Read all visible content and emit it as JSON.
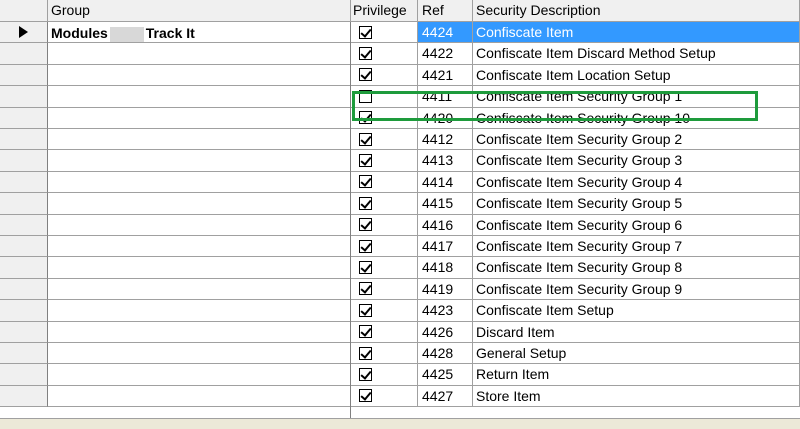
{
  "columns": {
    "group": "Group",
    "privilege": "Privilege",
    "ref": "Ref",
    "desc": "Security Description"
  },
  "group": {
    "prefix": "Modules",
    "suffix": "Track It"
  },
  "rows": [
    {
      "ref": "4424",
      "desc": "Confiscate Item",
      "checked": true
    },
    {
      "ref": "4422",
      "desc": "Confiscate Item Discard Method Setup",
      "checked": true
    },
    {
      "ref": "4421",
      "desc": "Confiscate Item Location Setup",
      "checked": true
    },
    {
      "ref": "4411",
      "desc": "Confiscate Item Security Group 1",
      "checked": false
    },
    {
      "ref": "4420",
      "desc": "Confiscate Item Security Group 10",
      "checked": true
    },
    {
      "ref": "4412",
      "desc": "Confiscate Item Security Group 2",
      "checked": true
    },
    {
      "ref": "4413",
      "desc": "Confiscate Item Security Group 3",
      "checked": true
    },
    {
      "ref": "4414",
      "desc": "Confiscate Item Security Group 4",
      "checked": true
    },
    {
      "ref": "4415",
      "desc": "Confiscate Item Security Group 5",
      "checked": true
    },
    {
      "ref": "4416",
      "desc": "Confiscate Item Security Group 6",
      "checked": true
    },
    {
      "ref": "4417",
      "desc": "Confiscate Item Security Group 7",
      "checked": true
    },
    {
      "ref": "4418",
      "desc": "Confiscate Item Security Group 8",
      "checked": true
    },
    {
      "ref": "4419",
      "desc": "Confiscate Item Security Group 9",
      "checked": true
    },
    {
      "ref": "4423",
      "desc": "Confiscate Item Setup",
      "checked": true
    },
    {
      "ref": "4426",
      "desc": "Discard Item",
      "checked": true
    },
    {
      "ref": "4428",
      "desc": "General Setup",
      "checked": true
    },
    {
      "ref": "4425",
      "desc": "Return Item",
      "checked": true
    },
    {
      "ref": "4427",
      "desc": "Store Item",
      "checked": true
    }
  ],
  "colors": {
    "selection": "#3399ff",
    "highlight": "#1e9b3c"
  }
}
